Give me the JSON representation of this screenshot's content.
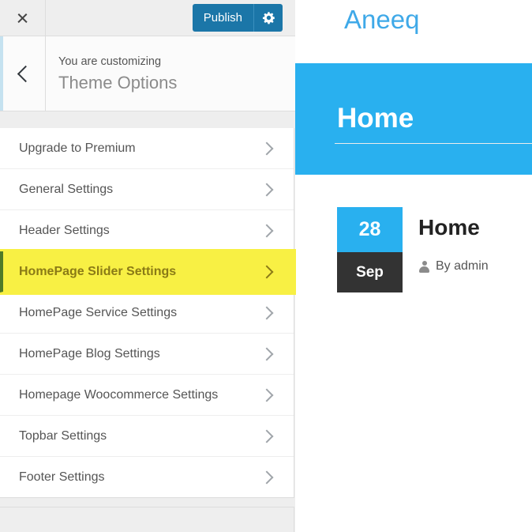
{
  "customizer": {
    "topbar": {
      "close_icon": "close-icon",
      "publish_label": "Publish",
      "settings_icon": "gear-icon",
      "publish_bg": "#1b76a8"
    },
    "header": {
      "back_icon": "chevron-left-icon",
      "customizing_label": "You are customizing",
      "panel_title": "Theme Options",
      "accent_color": "#c5e2f0"
    },
    "menu": {
      "chevron_icon": "chevron-right-icon",
      "highlight_color": "#f8f044",
      "highlight_text_color": "#8a7a16",
      "highlight_marker_color": "#4f7a28",
      "items": [
        {
          "label": "Upgrade to Premium",
          "highlighted": false
        },
        {
          "label": "General Settings",
          "highlighted": false
        },
        {
          "label": "Header Settings",
          "highlighted": false
        },
        {
          "label": "HomePage Slider Settings",
          "highlighted": true
        },
        {
          "label": "HomePage Service Settings",
          "highlighted": false
        },
        {
          "label": "HomePage Blog Settings",
          "highlighted": false
        },
        {
          "label": "Homepage Woocommerce Settings",
          "highlighted": false
        },
        {
          "label": "Topbar Settings",
          "highlighted": false
        },
        {
          "label": "Footer Settings",
          "highlighted": false
        }
      ]
    }
  },
  "preview": {
    "site_title": "Aneeq",
    "site_title_color": "#3fa9e8",
    "banner": {
      "title": "Home",
      "background": "#29b0ef"
    },
    "post": {
      "date_day": "28",
      "date_month": "Sep",
      "date_day_bg": "#29b0ef",
      "date_month_bg": "#333333",
      "title": "Home",
      "author_icon": "user-icon",
      "byline": "By admin"
    }
  }
}
